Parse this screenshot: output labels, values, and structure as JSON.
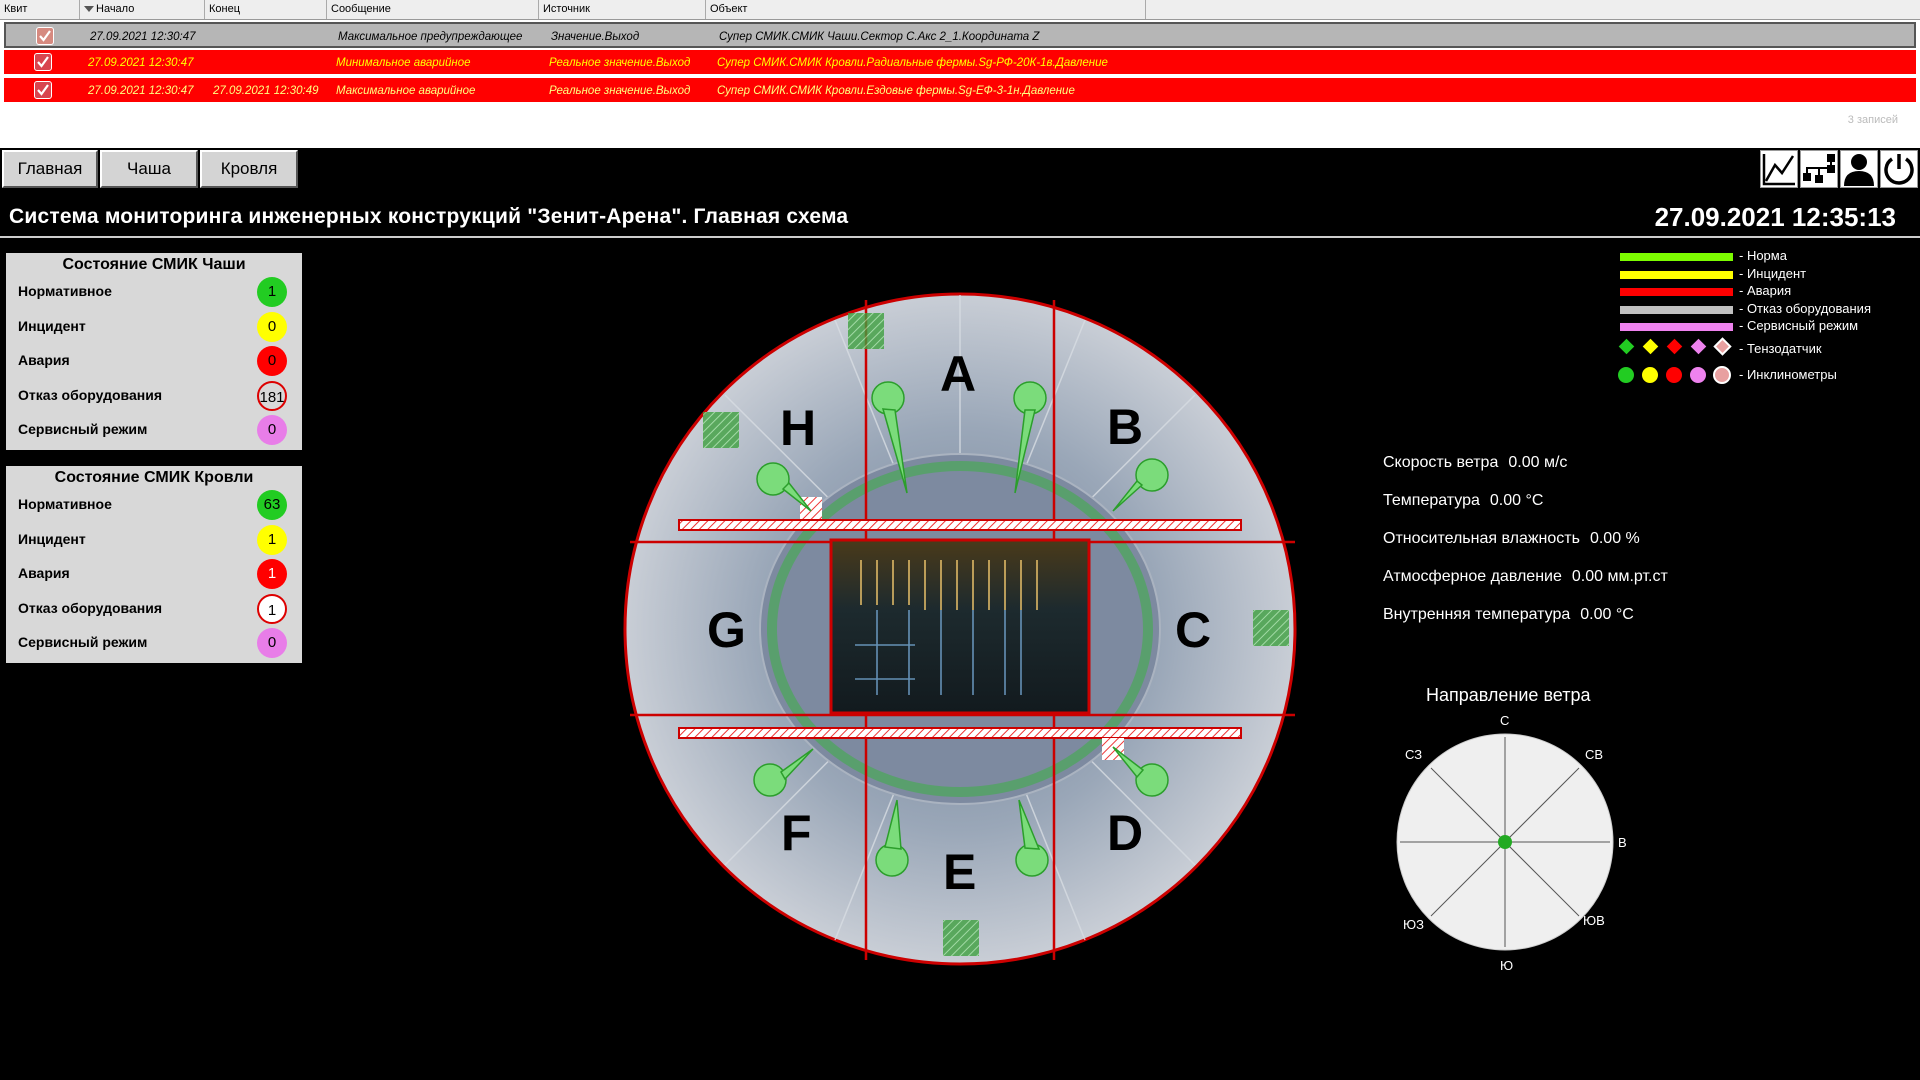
{
  "alarms": {
    "columns": [
      "Квит",
      "Начало",
      "Конец",
      "Сообщение",
      "Источник",
      "Объект"
    ],
    "rows": [
      {
        "start": "27.09.2021 12:30:47",
        "end": "",
        "message": "Максимальное предупреждающее",
        "source": "Значение.Выход",
        "object": "Супер СМИК.СМИК Чаши.Сектор С.Акс 2_1.Координата Z",
        "state": "warning-acked"
      },
      {
        "start": "27.09.2021 12:30:47",
        "end": "",
        "message": "Минимальное аварийное",
        "source": "Реальное значение.Выход",
        "object": "Супер СМИК.СМИК Кровли.Радиальные фермы.Sg-РФ-20К-1в.Давление",
        "state": "alarm"
      },
      {
        "start": "27.09.2021 12:30:47",
        "end": "27.09.2021 12:30:49",
        "message": "Максимальное аварийное",
        "source": "Реальное значение.Выход",
        "object": "Супер СМИК.СМИК Кровли.Ездовые фермы.Sg-ЕФ-3-1н.Давление",
        "state": "alarm"
      }
    ],
    "records": "3  записей"
  },
  "nav": {
    "tabs": [
      "Главная",
      "Чаша",
      "Кровля"
    ]
  },
  "toolbar": {
    "icons": [
      "trend-icon",
      "network-icon",
      "user-icon",
      "power-icon"
    ]
  },
  "title": "Система мониторинга инженерных конструкций \"Зенит-Арена\". Главная схема",
  "datetime": "27.09.2021 12:35:13",
  "bowl_status": {
    "title": "Состояние СМИК Чаши",
    "rows": [
      {
        "label": "Нормативное",
        "value": "1",
        "color": "#22cc22"
      },
      {
        "label": "Инцидент",
        "value": "0",
        "color": "#ffff00"
      },
      {
        "label": "Авария",
        "value": "0",
        "color": "#ff0000"
      },
      {
        "label": "Отказ оборудования",
        "value": "181",
        "color": "#d8d8d8"
      },
      {
        "label": "Сервисный режим",
        "value": "0",
        "color": "#e87de8"
      }
    ]
  },
  "roof_status": {
    "title": "Состояние СМИК Кровли",
    "rows": [
      {
        "label": "Нормативное",
        "value": "63",
        "color": "#22cc22"
      },
      {
        "label": "Инцидент",
        "value": "1",
        "color": "#ffff00"
      },
      {
        "label": "Авария",
        "value": "1",
        "color": "#ff0000"
      },
      {
        "label": "Отказ оборудования",
        "value": "1",
        "color": "#d8d8d8"
      },
      {
        "label": "Сервисный режим",
        "value": "0",
        "color": "#e87de8"
      }
    ]
  },
  "sectors": [
    "A",
    "B",
    "C",
    "D",
    "E",
    "F",
    "G",
    "H"
  ],
  "legend": {
    "bars": [
      {
        "label": "- Норма",
        "color": "#7cfc00"
      },
      {
        "label": "- Инцидент",
        "color": "#ffff00"
      },
      {
        "label": "- Авария",
        "color": "#ff0000"
      },
      {
        "label": "- Отказ оборудования",
        "color": "#c0c0c0"
      },
      {
        "label": "- Сервисный режим",
        "color": "#ee82ee"
      }
    ],
    "strain_gauge": "- Тензодатчик",
    "inclinometers": "- Инклинометры"
  },
  "weather": {
    "wind_speed_label": "Скорость ветра",
    "wind_speed": "0.00 м/с",
    "temperature_label": "Температура",
    "temperature": "0.00 °С",
    "humidity_label": "Относительная влажность",
    "humidity": "0.00 %",
    "pressure_label": "Атмосферное давление",
    "pressure": "0.00 мм.рт.ст",
    "inner_temp_label": "Внутренняя температура",
    "inner_temp": "0.00 °С"
  },
  "wind": {
    "title": "Направление ветра",
    "directions": {
      "n": "С",
      "ne": "СВ",
      "e": "В",
      "se": "ЮВ",
      "s": "Ю",
      "sw": "ЮЗ",
      "w": "",
      "nw": "СЗ"
    }
  }
}
